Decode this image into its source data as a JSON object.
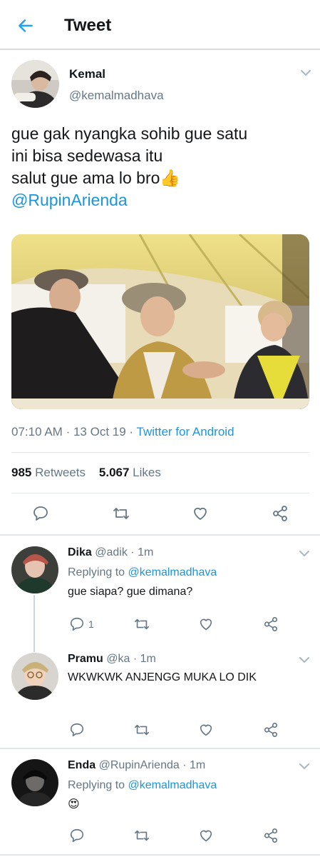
{
  "header": {
    "title": "Tweet",
    "back_icon": "arrow-left-icon",
    "accent": "#1da1f2"
  },
  "tweet": {
    "author_name": "Kemal",
    "author_handle": "@kemalmadhava",
    "text_lines": [
      "gue gak nyangka sohib gue satu",
      "ini bisa sedewasa itu",
      "salut gue ama lo bro"
    ],
    "emoji": "👍",
    "mention": "@RupinArienda",
    "time": "07:10 AM",
    "date": "13 Oct 19",
    "meta_sep": "·",
    "source": "Twitter for Android",
    "retweets_count": "985",
    "retweets_label": "Retweets",
    "likes_count": "5.067",
    "likes_label": "Likes",
    "actions": [
      "reply-icon",
      "retweet-icon",
      "like-icon",
      "share-icon"
    ]
  },
  "replies": [
    {
      "name": "Dika",
      "handle": "@adik",
      "time": "· 1m",
      "replying_label": "Replying to",
      "replying_to": "@kemalmadhava",
      "text": "gue siapa? gue dimana?",
      "reply_count": "1"
    },
    {
      "name": "Pramu",
      "handle": "@ka",
      "time": "· 1m",
      "text": "WKWKWK ANJENGG MUKA LO DIK"
    },
    {
      "name": "Enda",
      "handle": "@RupinArienda",
      "time": "· 1m",
      "replying_label": "Replying to",
      "replying_to": "@kemalmadhava",
      "text": "😍"
    }
  ],
  "colors": {
    "link": "#1b95e0",
    "muted": "#657786",
    "text": "#14171a",
    "divider": "#e1e8ed"
  }
}
